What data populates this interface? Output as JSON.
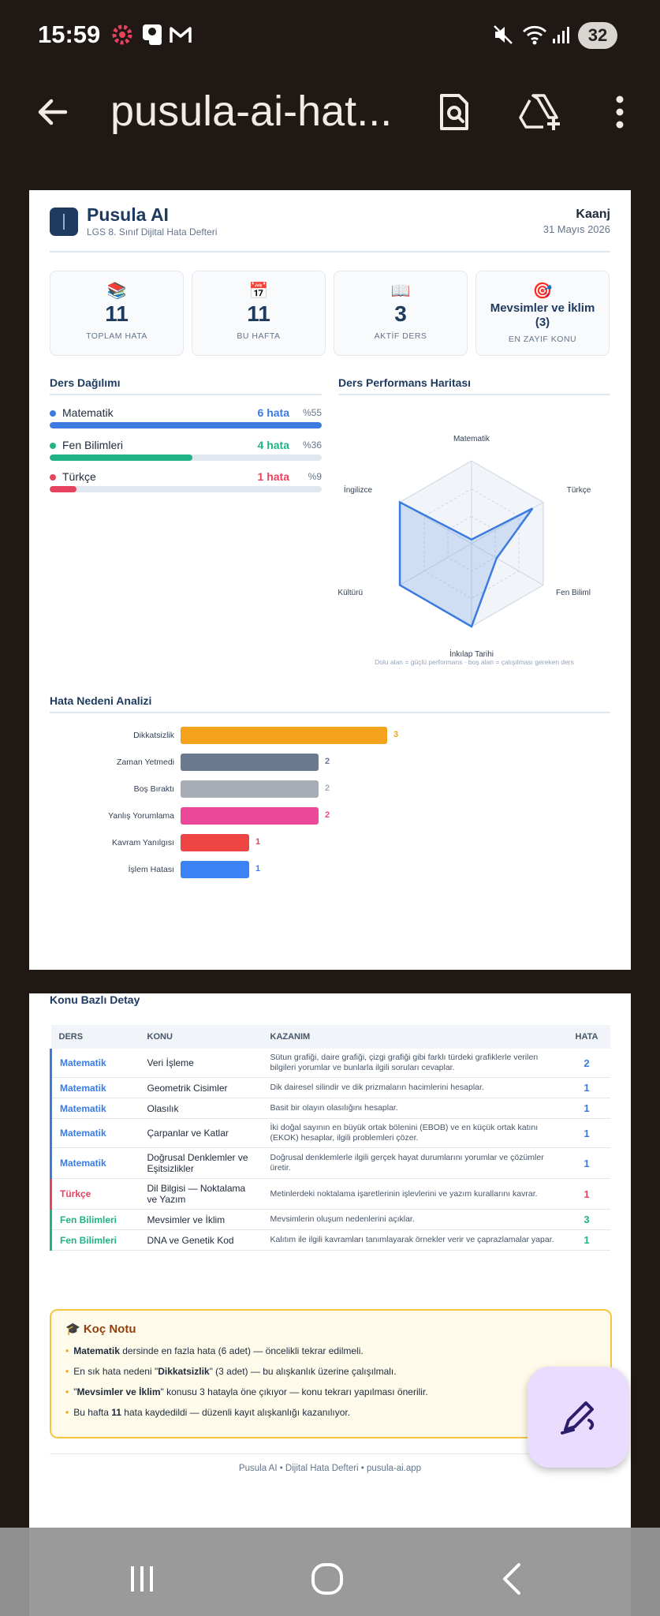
{
  "status": {
    "time": "15:59",
    "battery": "32"
  },
  "appbar": {
    "title": "pusula-ai-hat..."
  },
  "doc": {
    "brand": "Pusula AI",
    "subtitle": "LGS 8. Sınıf Dijital Hata Defteri",
    "user": "Kaanj",
    "date": "31 Mayıs 2026",
    "cards": [
      {
        "icon": "📚",
        "value": "11",
        "label": "TOPLAM HATA"
      },
      {
        "icon": "📅",
        "value": "11",
        "label": "BU HAFTA"
      },
      {
        "icon": "📖",
        "value": "3",
        "label": "AKTİF DERS"
      },
      {
        "icon": "🎯",
        "value": "Mevsimler ve İklim (3)",
        "label": "EN ZAYIF KONU"
      }
    ],
    "ders_dagilimi": {
      "title": "Ders Dağılımı",
      "rows": [
        {
          "name": "Matematik",
          "count": "6 hata",
          "pct": "%55",
          "color": "#3b7be0"
        },
        {
          "name": "Fen Bilimleri",
          "count": "4 hata",
          "pct": "%36",
          "color": "#1fb386"
        },
        {
          "name": "Türkçe",
          "count": "1 hata",
          "pct": "%9",
          "color": "#e8435e"
        }
      ]
    },
    "radar": {
      "title": "Ders Performans Haritası",
      "labels": [
        "Matematik",
        "Türkçe",
        "Fen Bilimleri",
        "İnkılap Tarihi",
        "Din Kültürü",
        "İngilizce"
      ],
      "visible_labels": [
        "Matematik",
        "Türkçe",
        "Fen Biliml",
        "İnkılap Tarihi",
        "in Kültürü",
        "İngilizce"
      ],
      "values": [
        0.05,
        0.85,
        0.35,
        1.0,
        1.0,
        1.0
      ],
      "caption": "Dolu alan = güçlü performans · boş alan = çalışılması gereken ders"
    },
    "hata_nedeni": {
      "title": "Hata Nedeni Analizi",
      "xmax": 3,
      "rows": [
        {
          "label": "Dikkatsizlik",
          "value": 3,
          "color": "#f4a21b"
        },
        {
          "label": "Zaman Yetmedi",
          "value": 2,
          "color": "#6b7a8f"
        },
        {
          "label": "Boş Bıraktı",
          "value": 2,
          "color": "#a7adb7"
        },
        {
          "label": "Yanlış Yorumlama",
          "value": 2,
          "color": "#ec4899"
        },
        {
          "label": "Kavram Yanılgısı",
          "value": 1,
          "color": "#ef4444"
        },
        {
          "label": "İşlem Hatası",
          "value": 1,
          "color": "#3b82f6"
        }
      ]
    },
    "konu": {
      "title": "Konu Bazlı Detay",
      "headers": [
        "DERS",
        "KONU",
        "KAZANIM",
        "HATA"
      ],
      "rows": [
        {
          "ders": "Matematik",
          "konu": "Veri İşleme",
          "kazanim": "Sütun grafiği, daire grafiği, çizgi grafiği gibi farklı türdeki grafiklerle verilen bilgileri yorumlar ve bunlarla ilgili soruları cevaplar.",
          "hata": "2",
          "color": "#3b7be0"
        },
        {
          "ders": "Matematik",
          "konu": "Geometrik Cisimler",
          "kazanim": "Dik dairesel silindir ve dik prizmaların hacimlerini hesaplar.",
          "hata": "1",
          "color": "#3b7be0"
        },
        {
          "ders": "Matematik",
          "konu": "Olasılık",
          "kazanim": "Basit bir olayın olasılığını hesaplar.",
          "hata": "1",
          "color": "#3b7be0"
        },
        {
          "ders": "Matematik",
          "konu": "Çarpanlar ve Katlar",
          "kazanim": "İki doğal sayının en büyük ortak bölenini (EBOB) ve en küçük ortak katını (EKOK) hesaplar, ilgili problemleri çözer.",
          "hata": "1",
          "color": "#3b7be0"
        },
        {
          "ders": "Matematik",
          "konu": "Doğrusal Denklemler ve Eşitsizlikler",
          "kazanim": "Doğrusal denklemlerle ilgili gerçek hayat durumlarını yorumlar ve çözümler üretir.",
          "hata": "1",
          "color": "#3b7be0"
        },
        {
          "ders": "Türkçe",
          "konu": "Dil Bilgisi — Noktalama ve Yazım",
          "kazanim": "Metinlerdeki noktalama işaretlerinin işlevlerini ve yazım kurallarını kavrar.",
          "hata": "1",
          "color": "#e8435e"
        },
        {
          "ders": "Fen Bilimleri",
          "konu": "Mevsimler ve İklim",
          "kazanim": "Mevsimlerin oluşum nedenlerini açıklar.",
          "hata": "3",
          "color": "#1fb386"
        },
        {
          "ders": "Fen Bilimleri",
          "konu": "DNA ve Genetik Kod",
          "kazanim": "Kalıtım ile ilgili kavramları tanımlayarak örnekler verir ve çaprazlamalar yapar.",
          "hata": "1",
          "color": "#1fb386"
        }
      ]
    },
    "koc": {
      "title": "🎓 Koç Notu",
      "items": [
        {
          "bold": "Matematik",
          "rest": " dersinde en fazla hata (6 adet) — öncelikli tekrar edilmeli."
        },
        {
          "pre": "En sık hata nedeni \"",
          "bold": "Dikkatsizlik",
          "rest": "\" (3 adet) — bu alışkanlık üzerine çalışılmalı."
        },
        {
          "pre": "\"",
          "bold": "Mevsimler ve İklim",
          "rest": "\" konusu 3 hatayla öne çıkıyor — konu tekrarı yapılması önerilir."
        },
        {
          "pre": "Bu hafta ",
          "bold": "11",
          "rest": " hata kaydedildi — düzenli kayıt alışkanlığı kazanılıyor."
        }
      ]
    },
    "footer": "Pusula AI • Dijital Hata Defteri • pusula-ai.app"
  }
}
